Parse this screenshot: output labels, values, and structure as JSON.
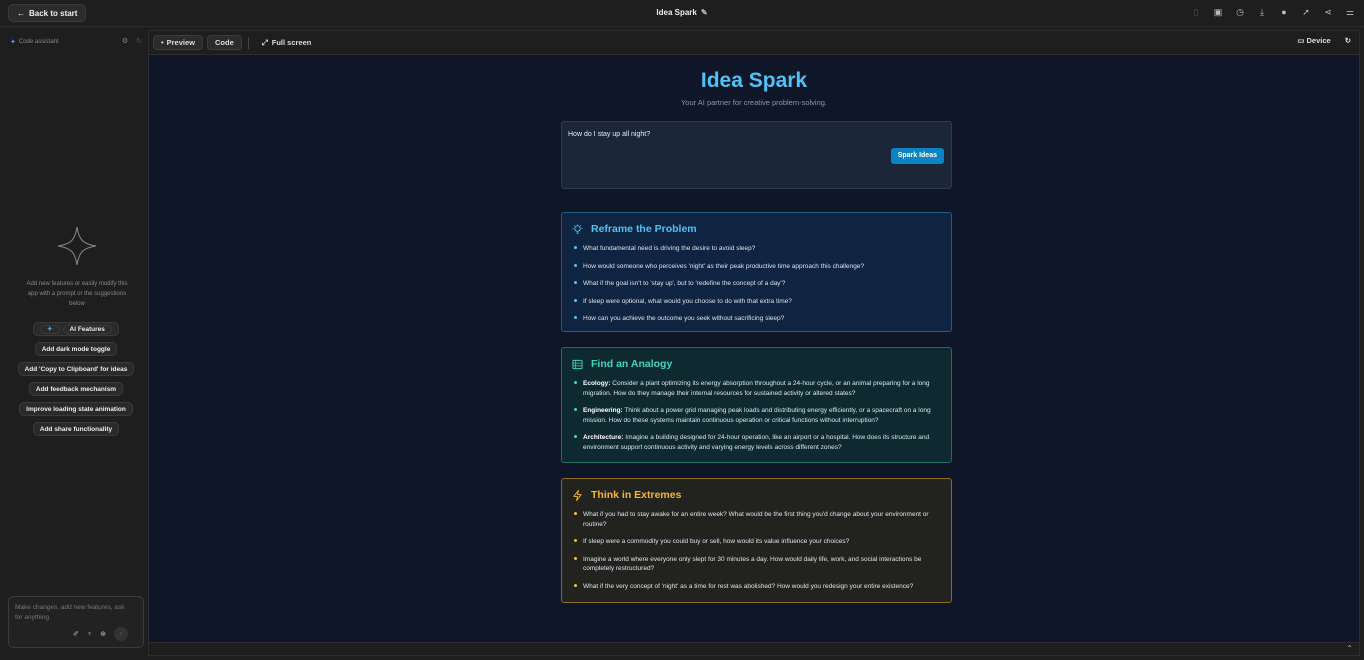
{
  "topbar": {
    "back_label": "Back to start",
    "app_title": "Idea Spark"
  },
  "sidebar": {
    "header": "Code assistant",
    "description": "Add new features or easily modify this app with a prompt or the suggestions below",
    "ai_features_label": "AI Features",
    "suggestions": [
      "Add dark mode toggle",
      "Add 'Copy to Clipboard' for ideas",
      "Add feedback mechanism",
      "Improve loading state animation",
      "Add share functionality"
    ],
    "chat_placeholder": "Make changes, add new features, ask for anything"
  },
  "toolbar": {
    "preview_label": "Preview",
    "code_label": "Code",
    "fullscreen_label": "Full screen",
    "device_label": "Device"
  },
  "app": {
    "title": "Idea Spark",
    "subtitle": "Your AI partner for creative problem-solving.",
    "question": "How do I stay up all night?",
    "spark_button": "Spark Ideas",
    "sections": {
      "reframe": {
        "title": "Reframe the Problem",
        "items": [
          "What fundamental need is driving the desire to avoid sleep?",
          "How would someone who perceives 'night' as their peak productive time approach this challenge?",
          "What if the goal isn't to 'stay up', but to 'redefine the concept of a day'?",
          "If sleep were optional, what would you choose to do with that extra time?",
          "How can you achieve the outcome you seek without sacrificing sleep?"
        ]
      },
      "analogy": {
        "title": "Find an Analogy",
        "items": [
          {
            "label": "Ecology:",
            "text": " Consider a plant optimizing its energy absorption throughout a 24-hour cycle, or an animal preparing for a long migration. How do they manage their internal resources for sustained activity or altered states?"
          },
          {
            "label": "Engineering:",
            "text": " Think about a power grid managing peak loads and distributing energy efficiently, or a spacecraft on a long mission. How do these systems maintain continuous operation or critical functions without interruption?"
          },
          {
            "label": "Architecture:",
            "text": " Imagine a building designed for 24-hour operation, like an airport or a hospital. How does its structure and environment support continuous activity and varying energy levels across different zones?"
          }
        ]
      },
      "extremes": {
        "title": "Think in Extremes",
        "items": [
          "What if you had to stay awake for an entire week? What would be the first thing you'd change about your environment or routine?",
          "If sleep were a commodity you could buy or sell, how would its value influence your choices?",
          "Imagine a world where everyone only slept for 30 minutes a day. How would daily life, work, and social interactions be completely restructured?",
          "What if the very concept of 'night' as a time for rest was abolished? How would you redesign your entire existence?"
        ]
      }
    }
  },
  "colors": {
    "accent_blue": "#4fc3f7",
    "accent_teal": "#3fd6c0",
    "accent_amber": "#f5b731",
    "button_blue": "#0b84c6",
    "preview_bg": "#0e1628"
  }
}
